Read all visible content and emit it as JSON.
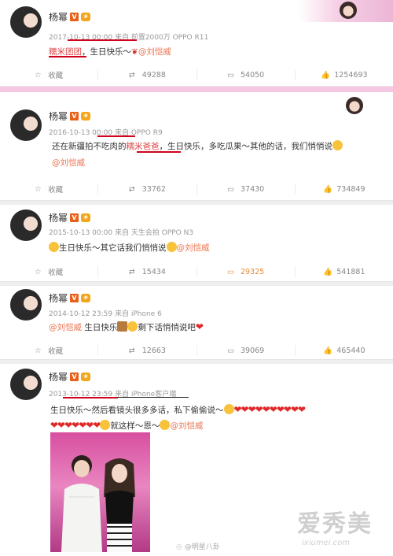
{
  "posts": [
    {
      "name": "杨幂",
      "meta": "2017-10-13 00:00 来自 前置2000万 OPPO R11",
      "text_hl": "糯米团团",
      "text_rest": "，生日快乐～",
      "mention": "@刘恺威",
      "actions": {
        "share": "收藏",
        "repost": "49288",
        "comment": "54050",
        "like": "1254693"
      }
    },
    {
      "name": "杨幂",
      "meta": "2016-10-13 00:00 来自 OPPO R9",
      "line1_a": "还在新疆拍不吃肉的",
      "line1_hl": "糯米爸爸",
      "line1_b": "，生日快乐，多吃瓜果～其他的话，我们悄悄说",
      "mention": "@刘恺威",
      "actions": {
        "share": "收藏",
        "repost": "33762",
        "comment": "37430",
        "like": "734849"
      }
    },
    {
      "name": "杨幂",
      "meta": "2015-10-13 00:00 来自 天生会拍 OPPO N3",
      "text": "生日快乐～其它话我们悄悄说",
      "mention": "@刘恺威",
      "actions": {
        "share": "收藏",
        "repost": "15434",
        "comment": "29325",
        "like": "541881"
      }
    },
    {
      "name": "杨幂",
      "meta": "2014-10-12 23:59 来自 iPhone 6",
      "mention": "@刘恺威",
      "text_a": "生日快乐",
      "text_b": "剩下话悄悄说吧",
      "actions": {
        "share": "收藏",
        "repost": "12663",
        "comment": "39069",
        "like": "465440"
      }
    },
    {
      "name": "杨幂",
      "meta": "2013-10-12 23:59 来自 iPhone客户端",
      "line1": "生日快乐～然后看镜头很多多话，私下偷偷说～",
      "line2": "就这样～恩～",
      "mention": "@刘恺威"
    }
  ],
  "watermark": {
    "brand": "爱秀美",
    "domain": "ixiumei.com",
    "weibo": "@明星八卦"
  },
  "colors": {
    "mention": "#eb7350",
    "underline": "#d0021b",
    "pink_bar": "#f5c7e2",
    "vip_badge": "#e8611a"
  }
}
